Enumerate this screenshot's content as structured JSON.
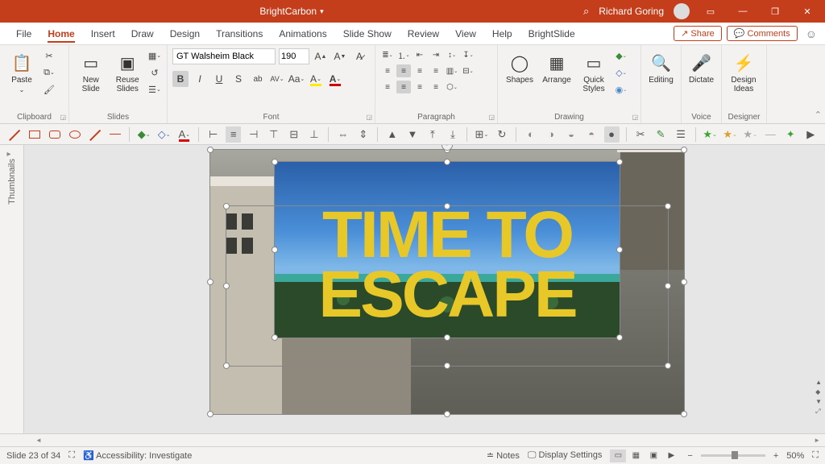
{
  "titlebar": {
    "docname": "BrightCarbon",
    "user": "Richard Goring"
  },
  "tabs": {
    "items": [
      "File",
      "Home",
      "Insert",
      "Draw",
      "Design",
      "Transitions",
      "Animations",
      "Slide Show",
      "Review",
      "View",
      "Help",
      "BrightSlide"
    ],
    "active": "Home",
    "share": "Share",
    "comments": "Comments"
  },
  "ribbon": {
    "clipboard": {
      "label": "Clipboard",
      "paste": "Paste"
    },
    "slides": {
      "label": "Slides",
      "new": "New\nSlide",
      "reuse": "Reuse\nSlides"
    },
    "font": {
      "label": "Font",
      "name": "GT Walsheim Black",
      "size": "190"
    },
    "paragraph": {
      "label": "Paragraph"
    },
    "drawing": {
      "label": "Drawing",
      "shapes": "Shapes",
      "arrange": "Arrange",
      "quick": "Quick\nStyles"
    },
    "editing": {
      "label": "",
      "editing": "Editing"
    },
    "voice": {
      "label": "Voice",
      "dictate": "Dictate"
    },
    "designer": {
      "label": "Designer",
      "ideas": "Design\nIdeas"
    }
  },
  "thumbnails": {
    "label": "Thumbnails"
  },
  "slide_content": {
    "line1": "TIME TO",
    "line2": "ESCAPE"
  },
  "status": {
    "slide": "Slide 23 of 34",
    "accessibility": "Accessibility: Investigate",
    "notes": "Notes",
    "display": "Display Settings",
    "zoom": "50%"
  }
}
